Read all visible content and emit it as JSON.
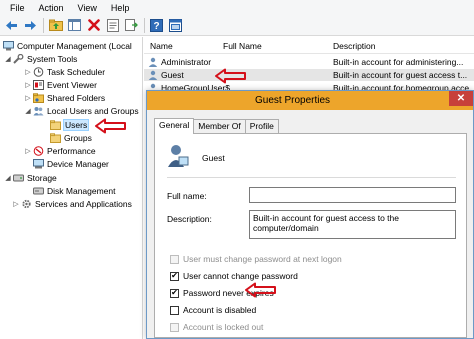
{
  "menu": [
    "File",
    "Action",
    "View",
    "Help"
  ],
  "toolbar_icons": [
    "back-arrow-icon",
    "forward-arrow-icon",
    "up-folder-icon",
    "show-tree-icon",
    "delete-icon",
    "properties-icon",
    "export-icon",
    "help-icon",
    "console-icon"
  ],
  "tree": {
    "root": "Computer Management (Local",
    "system_tools": "System Tools",
    "task_scheduler": "Task Scheduler",
    "event_viewer": "Event Viewer",
    "shared_folders": "Shared Folders",
    "local_users": "Local Users and Groups",
    "users": "Users",
    "groups": "Groups",
    "performance": "Performance",
    "device_manager": "Device Manager",
    "storage": "Storage",
    "disk_management": "Disk Management",
    "services": "Services and Applications"
  },
  "list": {
    "columns": [
      "Name",
      "Full Name",
      "Description"
    ],
    "rows": [
      {
        "name": "Administrator",
        "full_name": "",
        "description": "Built-in account for administering..."
      },
      {
        "name": "Guest",
        "full_name": "",
        "description": "Built-in account for guest access t..."
      },
      {
        "name": "HomeGroupUser$",
        "full_name": "",
        "description": "Built-in account for homegroup acce..."
      }
    ]
  },
  "dialog": {
    "title": "Guest Properties",
    "close": "✕",
    "tabs": [
      "General",
      "Member Of",
      "Profile"
    ],
    "username": "Guest",
    "full_name_label": "Full name:",
    "full_name_value": "",
    "description_label": "Description:",
    "description_value": "Built-in account for guest access to the computer/domain",
    "checkboxes": [
      {
        "label": "User must change password at next logon",
        "checked": false,
        "disabled": true
      },
      {
        "label": "User cannot change password",
        "checked": true,
        "disabled": false
      },
      {
        "label": "Password never expires",
        "checked": true,
        "disabled": false
      },
      {
        "label": "Account is disabled",
        "checked": false,
        "disabled": false
      },
      {
        "label": "Account is locked out",
        "checked": false,
        "disabled": true
      }
    ]
  },
  "colors": {
    "annotation_red": "#d4101a",
    "title_bar": "#eda52b",
    "close_button": "#c7403a",
    "selection": "#cce8ff"
  }
}
